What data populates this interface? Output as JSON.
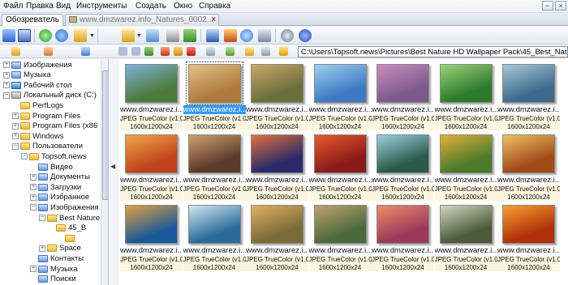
{
  "menu": [
    "Файл",
    "Правка",
    "Вид",
    "Инструменты",
    "Создать",
    "Окно",
    "Справка"
  ],
  "window_controls": [
    "−",
    "×"
  ],
  "tabs": {
    "active": "Обозреватель",
    "inactive": "www.dmzwarez.info_Natures_0002...",
    "close_glyph": "×"
  },
  "address": {
    "value": "C:\\Users\\Topsoft.news\\Pictures\\Best Nature HD Wallpaper Pack\\45_Best_Nature_HD_W"
  },
  "toolbar_icons": [
    "browse-icon",
    "fullscreen-icon",
    "refresh-icon",
    "refresh-all-icon",
    "move-folder-icon",
    "copy-icon",
    "convert-icon",
    "print-icon",
    "slideshow-icon",
    "save-icon",
    "screen-icon",
    "capture-icon",
    "compare-icon",
    "settings-icon",
    "info-icon"
  ],
  "tree": {
    "items": [
      {
        "label": "Изображения",
        "level": 1,
        "expander": "+",
        "icon": "folder-blue"
      },
      {
        "label": "Музыка",
        "level": 1,
        "expander": "+",
        "icon": "folder-blue"
      },
      {
        "label": "Рабочий стол",
        "level": 1,
        "expander": "+",
        "icon": "desktop"
      },
      {
        "label": "Локальный диск (C:)",
        "level": 1,
        "expander": "−",
        "icon": "drive"
      },
      {
        "label": "PerfLogs",
        "level": 2,
        "expander": "",
        "icon": "folder"
      },
      {
        "label": "Program Files",
        "level": 2,
        "expander": "+",
        "icon": "folder"
      },
      {
        "label": "Program Files (x86",
        "level": 2,
        "expander": "+",
        "icon": "folder"
      },
      {
        "label": "Windows",
        "level": 2,
        "expander": "+",
        "icon": "folder"
      },
      {
        "label": "Пользователи",
        "level": 2,
        "expander": "−",
        "icon": "folder"
      },
      {
        "label": "Topsoft.news",
        "level": 3,
        "expander": "−",
        "icon": "folder"
      },
      {
        "label": "Видео",
        "level": 4,
        "expander": "",
        "icon": "folder-blue"
      },
      {
        "label": "Документы",
        "level": 4,
        "expander": "+",
        "icon": "folder-blue"
      },
      {
        "label": "Загрузки",
        "level": 4,
        "expander": "+",
        "icon": "folder-blue"
      },
      {
        "label": "Избранное",
        "level": 4,
        "expander": "+",
        "icon": "folder-blue"
      },
      {
        "label": "Изображения",
        "level": 4,
        "expander": "−",
        "icon": "folder-blue"
      },
      {
        "label": "Best Nature",
        "level": 5,
        "expander": "−",
        "icon": "folder"
      },
      {
        "label": "45_B",
        "level": 6,
        "expander": "",
        "icon": "folder"
      },
      {
        "label": "",
        "level": 7,
        "expander": "",
        "icon": "folder"
      },
      {
        "label": "Space",
        "level": 5,
        "expander": "+",
        "icon": "folder"
      },
      {
        "label": "Контакты",
        "level": 4,
        "expander": "",
        "icon": "folder-blue"
      },
      {
        "label": "Музыка",
        "level": 4,
        "expander": "+",
        "icon": "folder-blue"
      },
      {
        "label": "Поиски",
        "level": 4,
        "expander": "",
        "icon": "folder-blue"
      }
    ]
  },
  "thumbnails": {
    "name": "www.dmzwarez.i...",
    "format": "JPEG TrueColor (v1.0)",
    "size": "1600x1200x24",
    "selected_index": 1,
    "colors": [
      [
        "#4d7a3a",
        "#7fb0d8"
      ],
      [
        "#b07a3c",
        "#e2c28a"
      ],
      [
        "#6b6f3a",
        "#cda66a"
      ],
      [
        "#3d7ac2",
        "#9fd0f0"
      ],
      [
        "#7c5a8c",
        "#c98cc0"
      ],
      [
        "#2e7a2c",
        "#9ad27a"
      ],
      [
        "#3c6a8c",
        "#a8c8d8"
      ],
      [
        "#c0431c",
        "#f2a64a"
      ],
      [
        "#5a3a2a",
        "#d0a070"
      ],
      [
        "#2a2a6a",
        "#e0703a"
      ],
      [
        "#8a1a1a",
        "#e85a2a"
      ],
      [
        "#2a5a4a",
        "#9ad0e0"
      ],
      [
        "#4a7a2a",
        "#e0b03a"
      ],
      [
        "#a04a1a",
        "#f0c060"
      ],
      [
        "#1a5a9a",
        "#e0a040"
      ],
      [
        "#2a6a9a",
        "#d0e8f0"
      ],
      [
        "#7a6a3a",
        "#e0b060"
      ],
      [
        "#4a6a3a",
        "#c0a070"
      ],
      [
        "#9a3a5a",
        "#f08a6a"
      ],
      [
        "#4a5a3a",
        "#d0d8c0"
      ],
      [
        "#b0300a",
        "#f8a030"
      ]
    ]
  }
}
